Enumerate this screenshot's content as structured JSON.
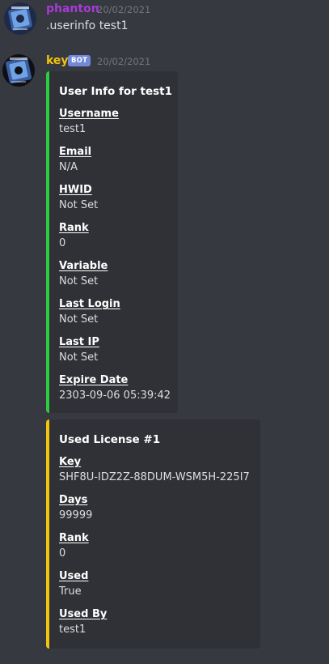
{
  "messages": [
    {
      "author": "phanton",
      "author_color": "#a63bd6",
      "timestamp": "20/02/2021",
      "text": ".userinfo test1"
    },
    {
      "author": "key",
      "author_color": "#f1c40f",
      "bot_tag": "BOT",
      "bot_tag_color": "#7289da",
      "timestamp": "20/02/2021"
    }
  ],
  "embeds": [
    {
      "color": "#2ecc40",
      "title": "User Info for test1",
      "fields": [
        {
          "name": "Username",
          "value": "test1"
        },
        {
          "name": "Email",
          "value": "N/A"
        },
        {
          "name": "HWID",
          "value": "Not Set"
        },
        {
          "name": "Rank",
          "value": "0"
        },
        {
          "name": "Variable",
          "value": "Not Set"
        },
        {
          "name": "Last Login",
          "value": "Not Set"
        },
        {
          "name": "Last IP",
          "value": "Not Set"
        },
        {
          "name": "Expire Date",
          "value": "2303-09-06 05:39:42"
        }
      ]
    },
    {
      "color": "#f1c40f",
      "title": "Used License #1",
      "fields": [
        {
          "name": "Key",
          "value": "SHF8U-IDZ2Z-88DUM-WSM5H-225I7"
        },
        {
          "name": "Days",
          "value": "99999"
        },
        {
          "name": "Rank",
          "value": "0"
        },
        {
          "name": "Used",
          "value": "True"
        },
        {
          "name": "Used By",
          "value": "test1"
        }
      ]
    }
  ],
  "icons": {
    "avatar_user": "avatar",
    "avatar_bot": "avatar"
  }
}
